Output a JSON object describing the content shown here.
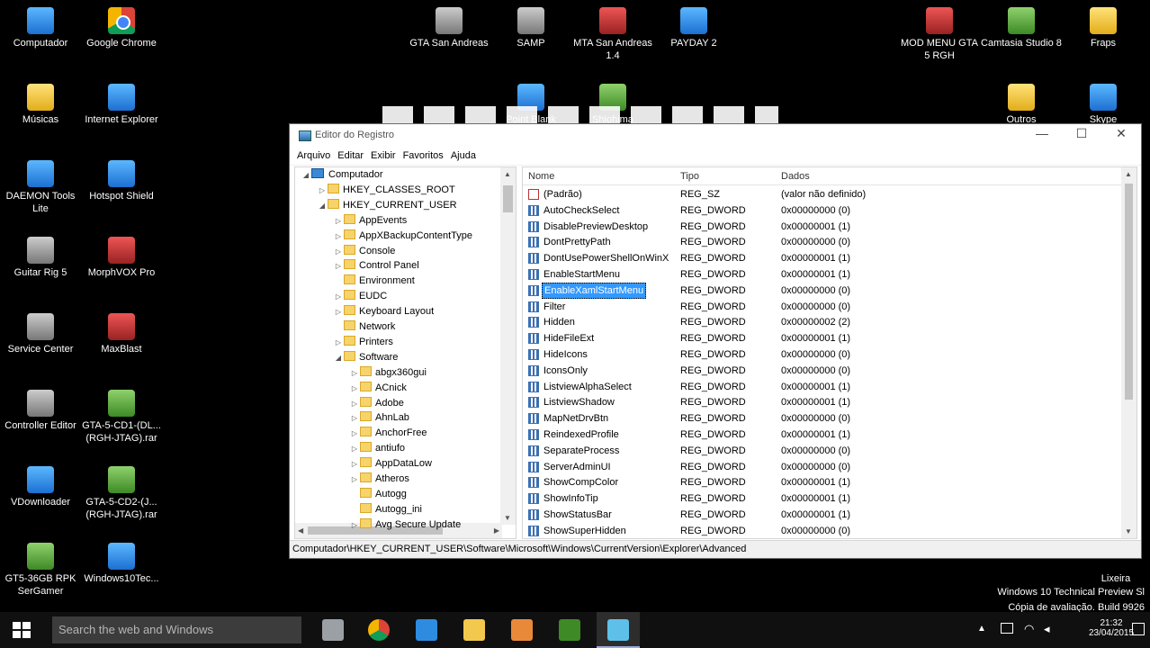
{
  "desktop": {
    "icons_left": [
      {
        "label": "Computador",
        "color": "blue"
      },
      {
        "label": "Google Chrome",
        "color": "chrome"
      },
      {
        "label": "Músicas",
        "color": "yellow"
      },
      {
        "label": "Internet Explorer",
        "color": "blue"
      },
      {
        "label": "DAEMON Tools Lite",
        "color": "blue"
      },
      {
        "label": "Hotspot Shield",
        "color": "blue"
      },
      {
        "label": "Guitar Rig 5",
        "color": "gray"
      },
      {
        "label": "MorphVOX Pro",
        "color": "red"
      },
      {
        "label": "Service Center",
        "color": "gray"
      },
      {
        "label": "MaxBlast",
        "color": "red"
      },
      {
        "label": "Controller Editor",
        "color": "gray"
      },
      {
        "label": "GTA-5-CD1-(DL... (RGH-JTAG).rar",
        "color": "green"
      },
      {
        "label": "VDownloader",
        "color": "blue"
      },
      {
        "label": "GTA-5-CD2-(J... (RGH-JTAG).rar",
        "color": "green"
      },
      {
        "label": "GT5-36GB RPK SerGamer",
        "color": "green"
      },
      {
        "label": "Windows10Tec...",
        "color": "blue"
      }
    ],
    "icons_top": [
      {
        "label": "GTA San Andreas",
        "color": "gray"
      },
      {
        "label": "SAMP",
        "color": "gray"
      },
      {
        "label": "MTA San Andreas 1.4",
        "color": "red"
      },
      {
        "label": "PAYDAY 2",
        "color": "blue"
      },
      {
        "label": "Point Blank",
        "color": "blue"
      },
      {
        "label": "Shiohima",
        "color": "green"
      },
      {
        "label": "MOD MENU GTA 5 RGH",
        "color": "red"
      },
      {
        "label": "Camtasia Studio 8",
        "color": "green"
      },
      {
        "label": "Fraps",
        "color": "yellow"
      },
      {
        "label": "Outros",
        "color": "yellow"
      },
      {
        "label": "Skype",
        "color": "blue"
      }
    ],
    "recycle_bin": "Lixeira",
    "os_line1": "Windows 10 Technical Preview Sl",
    "os_line2": "Cópia de avaliação. Build 9926"
  },
  "window": {
    "title": "Editor do Registro",
    "min": "—",
    "max": "☐",
    "close": "✕",
    "menu": [
      "Arquivo",
      "Editar",
      "Exibir",
      "Favoritos",
      "Ajuda"
    ],
    "tree": [
      {
        "label": "Computador",
        "level": 0,
        "expanded": true,
        "pc": true
      },
      {
        "label": "HKEY_CLASSES_ROOT",
        "level": 1,
        "expanded": false
      },
      {
        "label": "HKEY_CURRENT_USER",
        "level": 1,
        "expanded": true
      },
      {
        "label": "AppEvents",
        "level": 2,
        "expanded": false
      },
      {
        "label": "AppXBackupContentType",
        "level": 2,
        "expanded": false
      },
      {
        "label": "Console",
        "level": 2,
        "expanded": false
      },
      {
        "label": "Control Panel",
        "level": 2,
        "expanded": false
      },
      {
        "label": "Environment",
        "level": 2,
        "leaf": true
      },
      {
        "label": "EUDC",
        "level": 2,
        "expanded": false
      },
      {
        "label": "Keyboard Layout",
        "level": 2,
        "expanded": false
      },
      {
        "label": "Network",
        "level": 2,
        "leaf": true
      },
      {
        "label": "Printers",
        "level": 2,
        "expanded": false
      },
      {
        "label": "Software",
        "level": 2,
        "expanded": true
      },
      {
        "label": "abgx360gui",
        "level": 3,
        "expanded": false
      },
      {
        "label": "ACnick",
        "level": 3,
        "expanded": false
      },
      {
        "label": "Adobe",
        "level": 3,
        "expanded": false
      },
      {
        "label": "AhnLab",
        "level": 3,
        "expanded": false
      },
      {
        "label": "AnchorFree",
        "level": 3,
        "expanded": false
      },
      {
        "label": "antiufo",
        "level": 3,
        "expanded": false
      },
      {
        "label": "AppDataLow",
        "level": 3,
        "expanded": false
      },
      {
        "label": "Atheros",
        "level": 3,
        "expanded": false
      },
      {
        "label": "Autogg",
        "level": 3,
        "leaf": true
      },
      {
        "label": "Autogg_ini",
        "level": 3,
        "leaf": true
      },
      {
        "label": "Avg Secure Update",
        "level": 3,
        "expanded": false
      }
    ],
    "columns": {
      "name": "Nome",
      "type": "Tipo",
      "data": "Dados"
    },
    "values": [
      {
        "name": "(Padrão)",
        "type": "REG_SZ",
        "data": "(valor não definido)"
      },
      {
        "name": "AutoCheckSelect",
        "type": "REG_DWORD",
        "data": "0x00000000 (0)"
      },
      {
        "name": "DisablePreviewDesktop",
        "type": "REG_DWORD",
        "data": "0x00000001 (1)"
      },
      {
        "name": "DontPrettyPath",
        "type": "REG_DWORD",
        "data": "0x00000000 (0)"
      },
      {
        "name": "DontUsePowerShellOnWinX",
        "type": "REG_DWORD",
        "data": "0x00000001 (1)"
      },
      {
        "name": "EnableStartMenu",
        "type": "REG_DWORD",
        "data": "0x00000001 (1)"
      },
      {
        "name": "EnableXamlStartMenu",
        "type": "REG_DWORD",
        "data": "0x00000000 (0)",
        "selected": true
      },
      {
        "name": "Filter",
        "type": "REG_DWORD",
        "data": "0x00000000 (0)"
      },
      {
        "name": "Hidden",
        "type": "REG_DWORD",
        "data": "0x00000002 (2)"
      },
      {
        "name": "HideFileExt",
        "type": "REG_DWORD",
        "data": "0x00000001 (1)"
      },
      {
        "name": "HideIcons",
        "type": "REG_DWORD",
        "data": "0x00000000 (0)"
      },
      {
        "name": "IconsOnly",
        "type": "REG_DWORD",
        "data": "0x00000000 (0)"
      },
      {
        "name": "ListviewAlphaSelect",
        "type": "REG_DWORD",
        "data": "0x00000001 (1)"
      },
      {
        "name": "ListviewShadow",
        "type": "REG_DWORD",
        "data": "0x00000001 (1)"
      },
      {
        "name": "MapNetDrvBtn",
        "type": "REG_DWORD",
        "data": "0x00000000 (0)"
      },
      {
        "name": "ReindexedProfile",
        "type": "REG_DWORD",
        "data": "0x00000001 (1)"
      },
      {
        "name": "SeparateProcess",
        "type": "REG_DWORD",
        "data": "0x00000000 (0)"
      },
      {
        "name": "ServerAdminUI",
        "type": "REG_DWORD",
        "data": "0x00000000 (0)"
      },
      {
        "name": "ShowCompColor",
        "type": "REG_DWORD",
        "data": "0x00000001 (1)"
      },
      {
        "name": "ShowInfoTip",
        "type": "REG_DWORD",
        "data": "0x00000001 (1)"
      },
      {
        "name": "ShowStatusBar",
        "type": "REG_DWORD",
        "data": "0x00000001 (1)"
      },
      {
        "name": "ShowSuperHidden",
        "type": "REG_DWORD",
        "data": "0x00000000 (0)"
      }
    ],
    "status_path": "Computador\\HKEY_CURRENT_USER\\Software\\Microsoft\\Windows\\CurrentVersion\\Explorer\\Advanced"
  },
  "taskbar": {
    "search_placeholder": "Search the web and Windows",
    "time": "21:32",
    "date": "23/04/2015",
    "pinned": [
      {
        "name": "task-view-icon",
        "color": "#9aa0a6"
      },
      {
        "name": "chrome-icon",
        "color": "chrome"
      },
      {
        "name": "internet-explorer-icon",
        "color": "#2d8ce0"
      },
      {
        "name": "file-explorer-icon",
        "color": "#f2c94c"
      },
      {
        "name": "media-player-icon",
        "color": "#e8893a"
      },
      {
        "name": "camtasia-icon",
        "color": "#3d8a26"
      },
      {
        "name": "regedit-icon",
        "color": "#5ec0e8"
      }
    ]
  }
}
